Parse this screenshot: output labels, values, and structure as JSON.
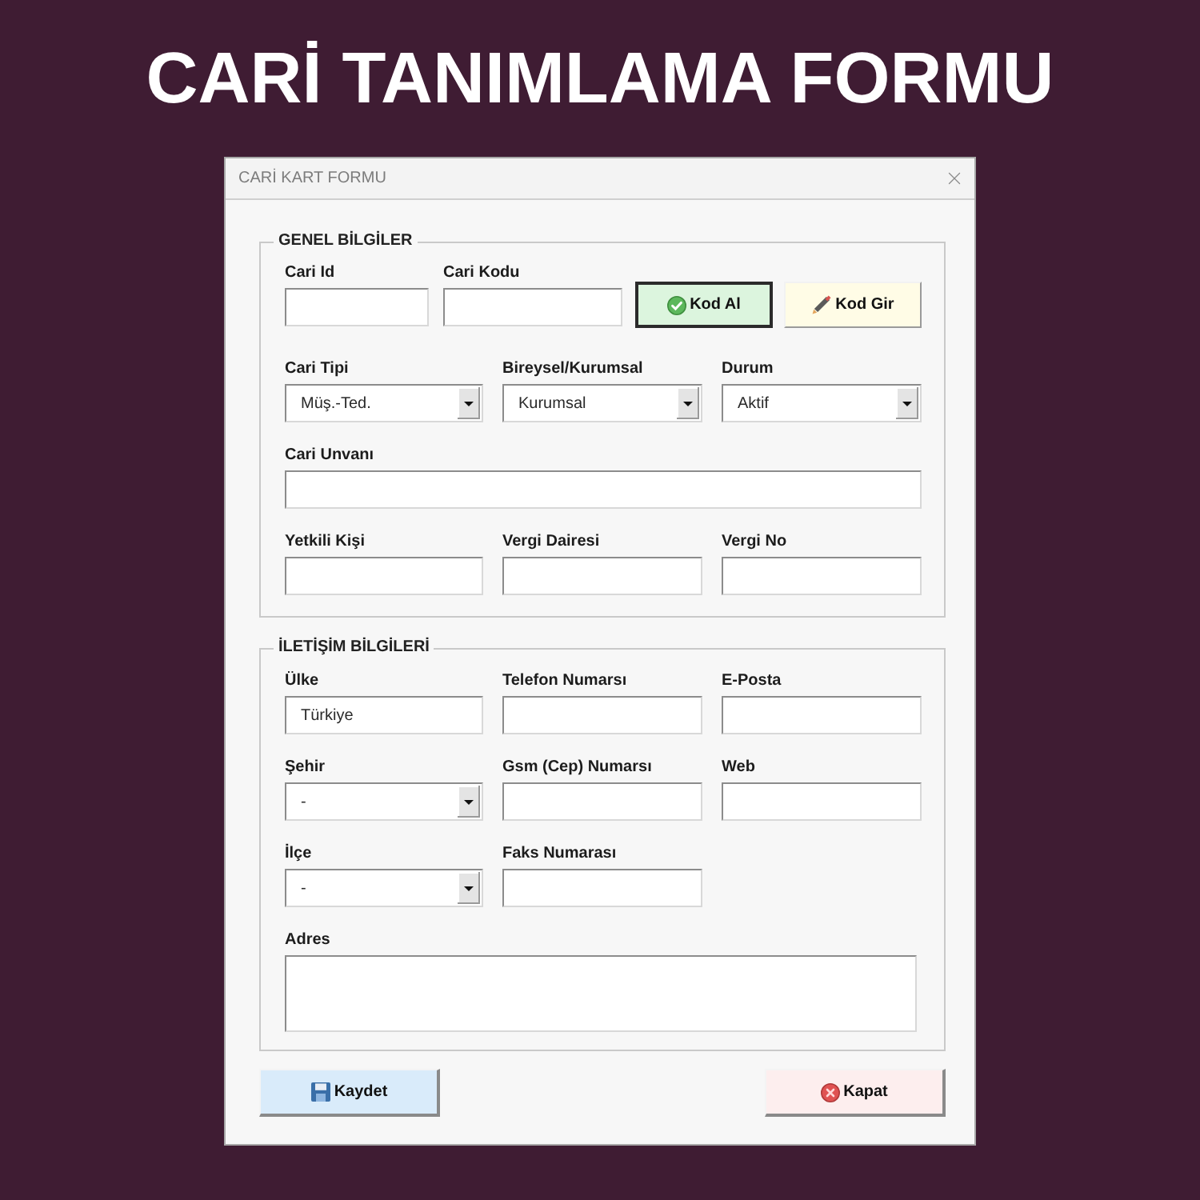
{
  "heading": "CARİ TANIMLAMA FORMU",
  "window": {
    "title": "CARİ KART FORMU"
  },
  "groups": [
    {
      "title": "GENEL BİLGİLER",
      "rows": [
        {
          "kind": "code",
          "fields": [
            {
              "kind": "text",
              "label": "Cari Id"
            },
            {
              "kind": "text",
              "label": "Cari Kodu"
            }
          ],
          "buttons": [
            {
              "kind": "get_code",
              "label": "Kod Al",
              "focused": true
            },
            {
              "kind": "enter_code",
              "label": "Kod Gir",
              "focused": false
            }
          ]
        },
        {
          "kind": "grid",
          "fields": [
            {
              "kind": "combo",
              "label": "Cari Tipi",
              "value": "Müş.-Ted."
            },
            {
              "kind": "combo",
              "label": "Bireysel/Kurumsal",
              "value": "Kurumsal"
            },
            {
              "kind": "combo",
              "label": "Durum",
              "value": "Aktif"
            }
          ]
        },
        {
          "kind": "wide",
          "fields": [
            {
              "kind": "text",
              "label": "Cari Unvanı"
            }
          ]
        },
        {
          "kind": "grid",
          "fields": [
            {
              "kind": "text",
              "label": "Yetkili Kişi"
            },
            {
              "kind": "text",
              "label": "Vergi Dairesi"
            },
            {
              "kind": "text",
              "label": "Vergi No"
            }
          ]
        }
      ]
    },
    {
      "title": "İLETİŞİM BİLGİLERİ",
      "rows": [
        {
          "kind": "grid",
          "fields": [
            {
              "kind": "text",
              "label": "Ülke",
              "value": "Türkiye"
            },
            {
              "kind": "text",
              "label": "Telefon Numarsı"
            },
            {
              "kind": "text",
              "label": "E-Posta"
            }
          ]
        },
        {
          "kind": "grid",
          "fields": [
            {
              "kind": "combo",
              "label": "Şehir",
              "value": "-"
            },
            {
              "kind": "text",
              "label": "Gsm (Cep) Numarsı"
            },
            {
              "kind": "text",
              "label": "Web"
            }
          ]
        },
        {
          "kind": "grid",
          "fields": [
            {
              "kind": "combo",
              "label": "İlçe",
              "value": "-"
            },
            {
              "kind": "text",
              "label": "Faks Numarası"
            }
          ]
        },
        {
          "kind": "wide",
          "fields": [
            {
              "kind": "textarea",
              "label": "Adres"
            }
          ]
        }
      ]
    }
  ],
  "buttons": [
    {
      "kind": "save",
      "label": "Kaydet"
    },
    {
      "kind": "close",
      "label": "Kapat"
    }
  ]
}
